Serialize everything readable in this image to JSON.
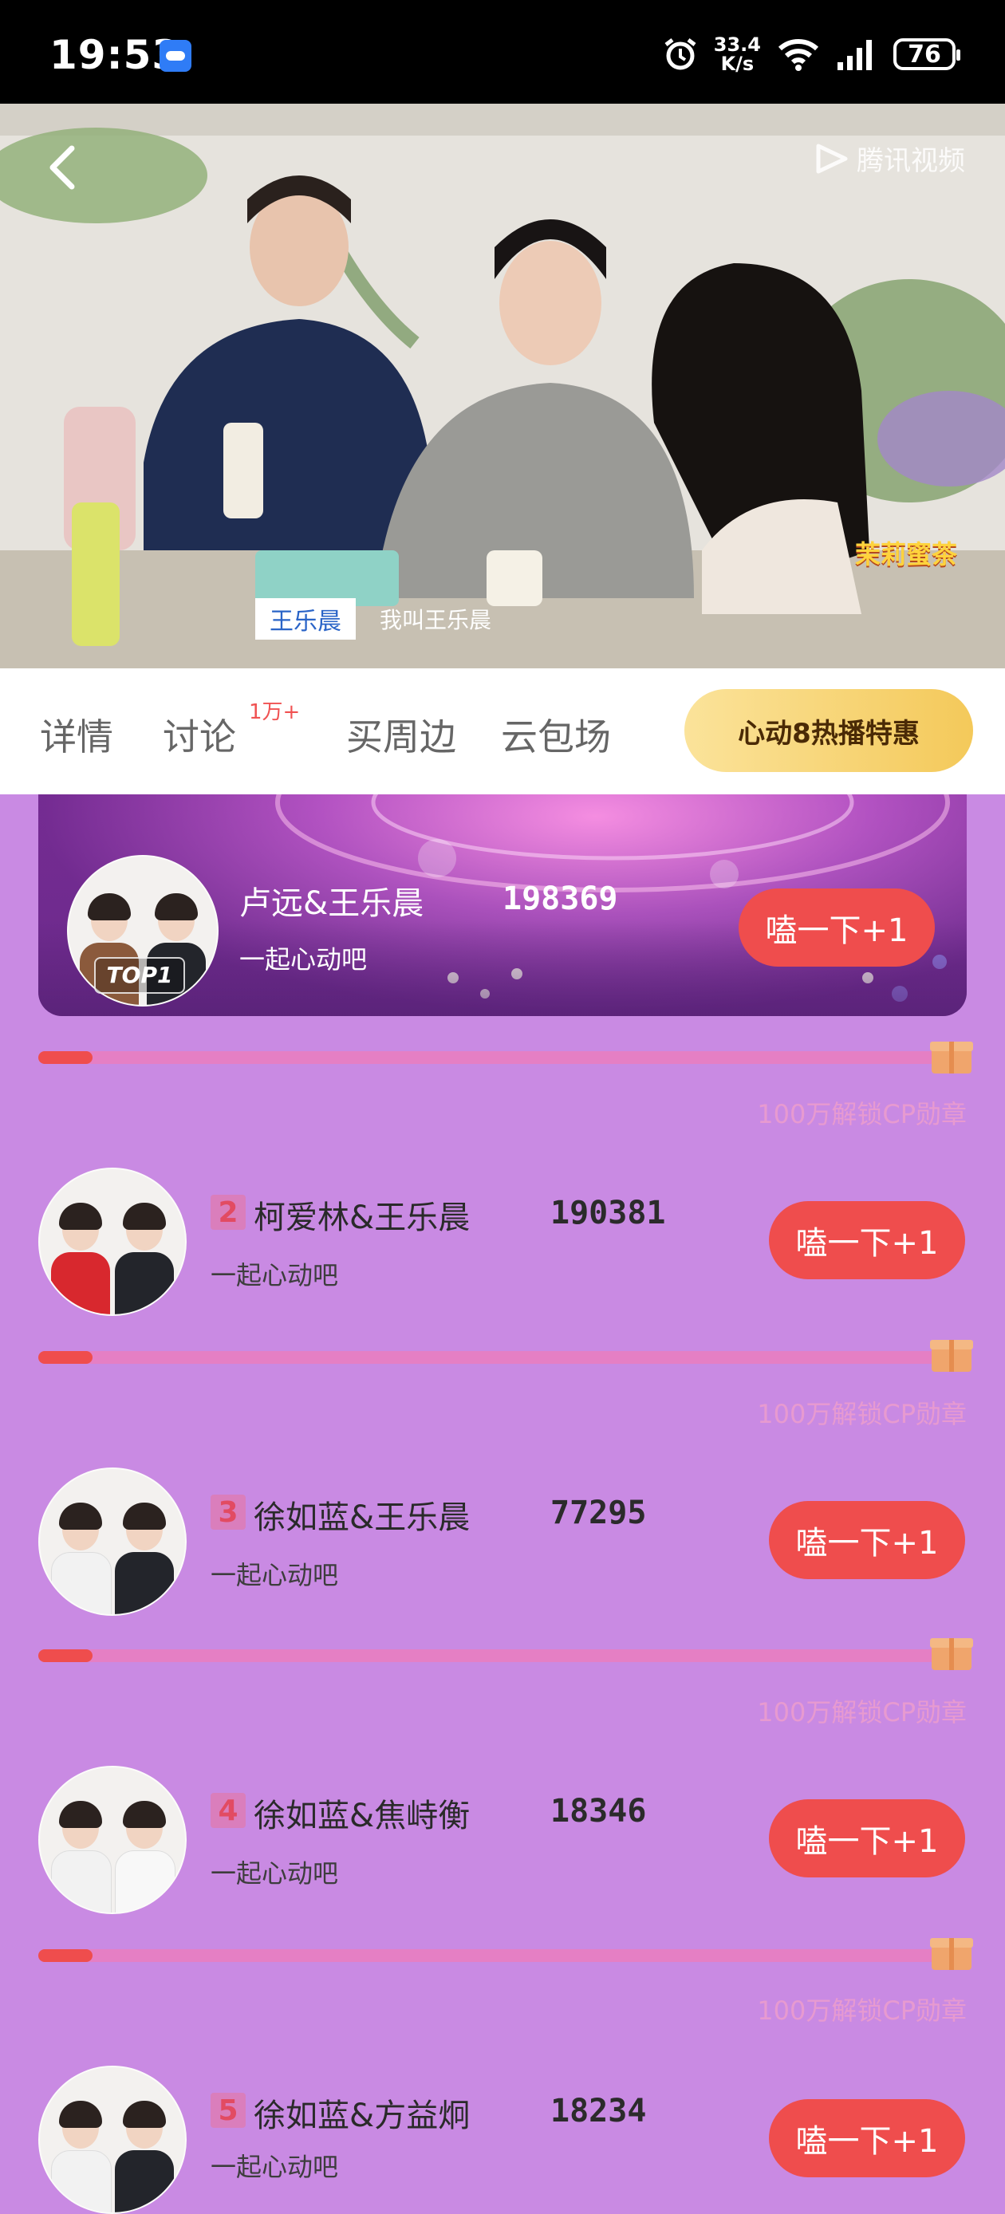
{
  "status_bar": {
    "time": "19:53",
    "speed_value": "33.4",
    "speed_unit": "K/s",
    "battery": "76"
  },
  "video": {
    "watermark": "腾讯视频",
    "caption_name": "王乐晨",
    "caption_text": "我叫王乐晨",
    "brand_badge": "茉莉蜜茶"
  },
  "tabs": [
    {
      "label": "详情"
    },
    {
      "label": "讨论"
    },
    {
      "label": "买周边"
    },
    {
      "label": "云包场"
    }
  ],
  "discussion_badge": "1万+",
  "promo_button": "心动8热播特惠",
  "top1": {
    "tag": "TOP1",
    "name": "卢远&王乐晨",
    "subtitle": "一起心动吧",
    "votes": "198369",
    "button": "嗑一下+1",
    "progress": 0.06,
    "unlock": "100万解锁CP勋章"
  },
  "ranking": [
    {
      "rank": "2",
      "name": "柯爱林&王乐晨",
      "subtitle": "一起心动吧",
      "votes": "190381",
      "button": "嗑一下+1",
      "progress": 0.06,
      "unlock": "100万解锁CP勋章"
    },
    {
      "rank": "3",
      "name": "徐如蓝&王乐晨",
      "subtitle": "一起心动吧",
      "votes": "77295",
      "button": "嗑一下+1",
      "progress": 0.06,
      "unlock": "100万解锁CP勋章"
    },
    {
      "rank": "4",
      "name": "徐如蓝&焦峙衡",
      "subtitle": "一起心动吧",
      "votes": "18346",
      "button": "嗑一下+1",
      "progress": 0.06,
      "unlock": "100万解锁CP勋章"
    },
    {
      "rank": "5",
      "name": "徐如蓝&方益炯",
      "subtitle": "一起心动吧",
      "votes": "18234",
      "button": "嗑一下+1"
    }
  ],
  "colors": {
    "background": "#c98ae3",
    "accent_red": "#ef4d4d",
    "promo_gold": "#f4c95a"
  }
}
